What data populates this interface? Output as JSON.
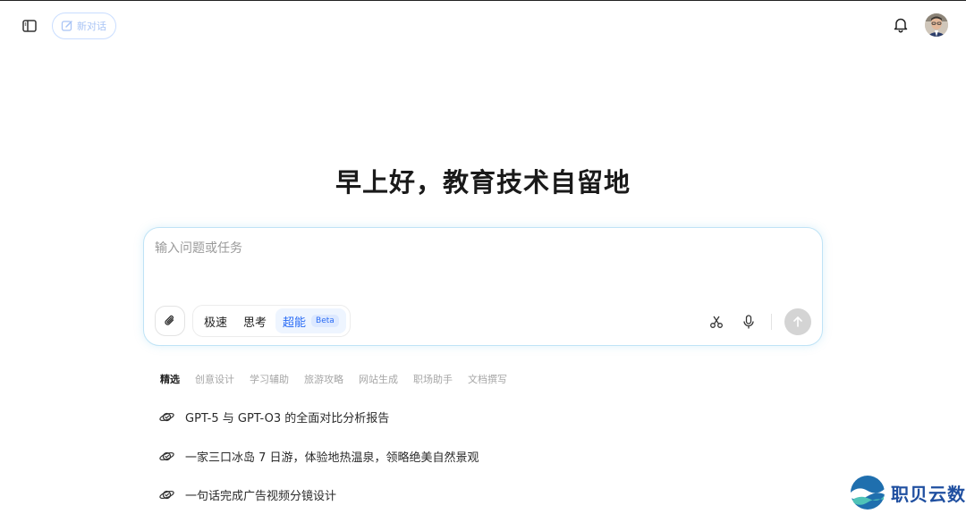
{
  "header": {
    "new_chat_label": "新对话",
    "sidebar_toggle_icon": "sidebar-toggle-icon",
    "new_chat_icon": "edit-icon",
    "bell_icon": "bell-icon"
  },
  "greeting": "早上好，教育技术自留地",
  "composer": {
    "placeholder": "输入问题或任务",
    "modes": [
      "极速",
      "思考",
      "超能"
    ],
    "active_mode": "超能",
    "beta_badge": "Beta"
  },
  "categories": [
    "精选",
    "创意设计",
    "学习辅助",
    "旅游攻略",
    "网站生成",
    "职场助手",
    "文档撰写"
  ],
  "active_category": "精选",
  "suggestions": [
    "GPT-5 与 GPT-O3 的全面对比分析报告",
    "一家三口冰岛 7 日游，体验地热温泉，领略绝美自然景观",
    "一句话完成广告视频分镜设计"
  ],
  "watermark": "职贝云数",
  "colors": {
    "accent": "#2a6cf5",
    "border": "#bfe3f6",
    "watermark": "#1f4fa0"
  }
}
